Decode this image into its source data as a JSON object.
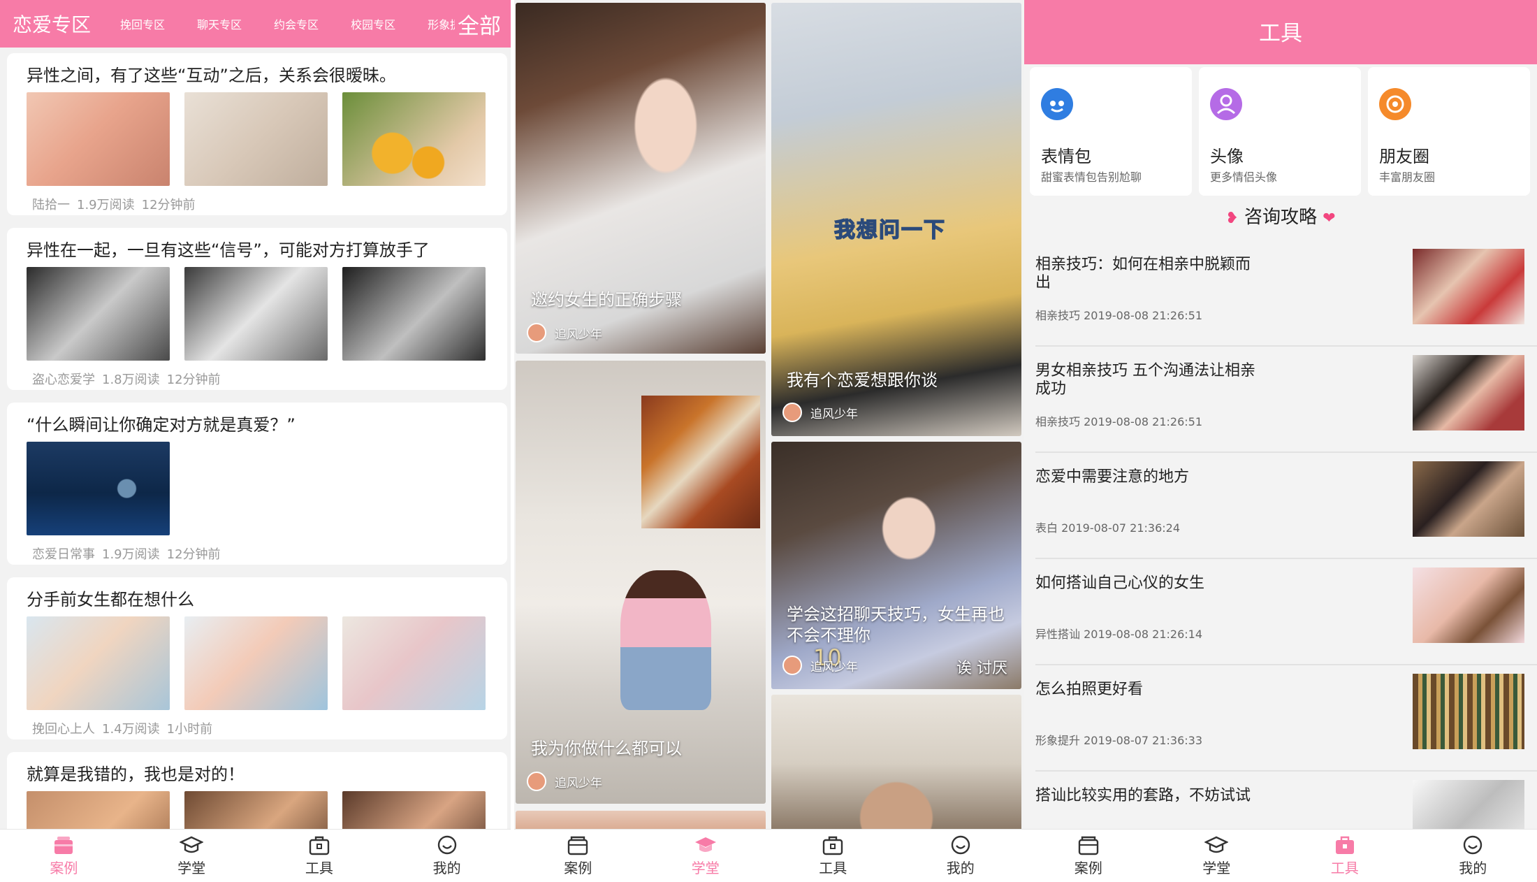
{
  "colors": {
    "accent": "#f77ba7",
    "accent_dark": "#f2467f",
    "meta_text": "#999999"
  },
  "panel1": {
    "header": {
      "title": "恋爱专区",
      "tabs": [
        "挽回专区",
        "聊天专区",
        "约会专区",
        "校园专区",
        "形象提"
      ],
      "all_label": "全部"
    },
    "articles": [
      {
        "title": "异性之间，有了这些“互动”之后，关系会很暧昧。",
        "author": "陆拾一",
        "reads": "1.9万阅读",
        "time": "12分钟前"
      },
      {
        "title": "异性在一起，一旦有这些“信号”，可能对方打算放手了",
        "author": "盗心恋爱学",
        "reads": "1.8万阅读",
        "time": "12分钟前"
      },
      {
        "title": "“什么瞬间让你确定对方就是真爱？”",
        "author": "恋爱日常事",
        "reads": "1.9万阅读",
        "time": "12分钟前"
      },
      {
        "title": "分手前女生都在想什么",
        "author": "挽回心上人",
        "reads": "1.4万阅读",
        "time": "1小时前"
      },
      {
        "title": "就算是我错的，我也是对的！",
        "author": "",
        "reads": "",
        "time": ""
      }
    ]
  },
  "panel2": {
    "videos": [
      {
        "caption": "邀约女生的正确步骤",
        "author": "追风少年"
      },
      {
        "caption": "我为你做什么都可以",
        "author": "追风少年"
      },
      {
        "caption": "我有个恋爱想跟你谈",
        "author": "追风少年",
        "overlay": "我想问一下"
      },
      {
        "caption": "学会这招聊天技巧，女生再也不会不理你",
        "author": "追风少年",
        "overlay": "诶 讨厌",
        "overlay_num": "10"
      }
    ]
  },
  "panel3": {
    "header_title": "工具",
    "tools": [
      {
        "name": "表情包",
        "desc": "甜蜜表情包告别尬聊",
        "icon": "emoji-icon",
        "color": "#2f7de1"
      },
      {
        "name": "头像",
        "desc": "更多情侣头像",
        "icon": "avatar-icon",
        "color": "#b56be6"
      },
      {
        "name": "朋友圈",
        "desc": "丰富朋友圈",
        "icon": "camera-aperture-icon",
        "color": "#f58a2b"
      }
    ],
    "section_title": "咨询攻略",
    "articles": [
      {
        "title": "相亲技巧：如何在相亲中脱颖而出",
        "category": "相亲技巧",
        "time": "2019-08-08 21:26:51"
      },
      {
        "title": "男女相亲技巧 五个沟通法让相亲成功",
        "category": "相亲技巧",
        "time": "2019-08-08 21:26:51"
      },
      {
        "title": "恋爱中需要注意的地方",
        "category": "表白",
        "time": "2019-08-07 21:36:24"
      },
      {
        "title": "如何搭讪自己心仪的女生",
        "category": "异性搭讪",
        "time": "2019-08-08 21:26:14"
      },
      {
        "title": "怎么拍照更好看",
        "category": "形象提升",
        "time": "2019-08-07 21:36:33"
      },
      {
        "title": "搭讪比较实用的套路，不妨试试",
        "category": "",
        "time": ""
      }
    ]
  },
  "tabbar": {
    "items": [
      "案例",
      "学堂",
      "工具",
      "我的"
    ]
  }
}
